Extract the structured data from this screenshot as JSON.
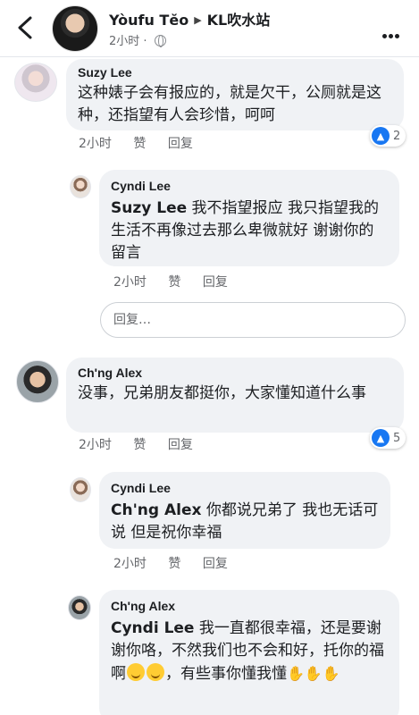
{
  "header": {
    "author": "Yòufu Tĕo",
    "arrow": "▶",
    "group": "KL吹水站",
    "time": "2小时",
    "separator": "·"
  },
  "actions": {
    "like": "赞",
    "reply": "回复"
  },
  "reply_box": {
    "placeholder": "回复…"
  },
  "comments": [
    {
      "name": "Suzy Lee",
      "text": "这种婊子会有报应的，就是欠干，公厕就是这种，还指望有人会珍惜，呵呵",
      "time": "2小时",
      "reaction_count": "2"
    },
    {
      "name": "Cyndi Lee",
      "mention": "Suzy Lee",
      "text": " 我不指望报应 我只指望我的生活不再像过去那么卑微就好 谢谢你的留言",
      "time": "2小时"
    },
    {
      "name": "Ch'ng Alex",
      "text": "没事，兄弟朋友都挺你，大家懂知道什么事",
      "time": "2小时",
      "reaction_count": "5"
    },
    {
      "name": "Cyndi Lee",
      "mention": "Ch'ng Alex",
      "text": " 你都说兄弟了 我也无话可说 但是祝你幸福",
      "time": "2小时"
    },
    {
      "name": "Ch'ng Alex",
      "mention": "Cyndi Lee",
      "text_a": " 我一直都很幸福，还是要谢谢你咯，不然我们也不会和好，托你的福啊",
      "text_b": "，有些事你懂我懂"
    }
  ],
  "icons": {
    "like": "👍",
    "clap": "👏"
  }
}
